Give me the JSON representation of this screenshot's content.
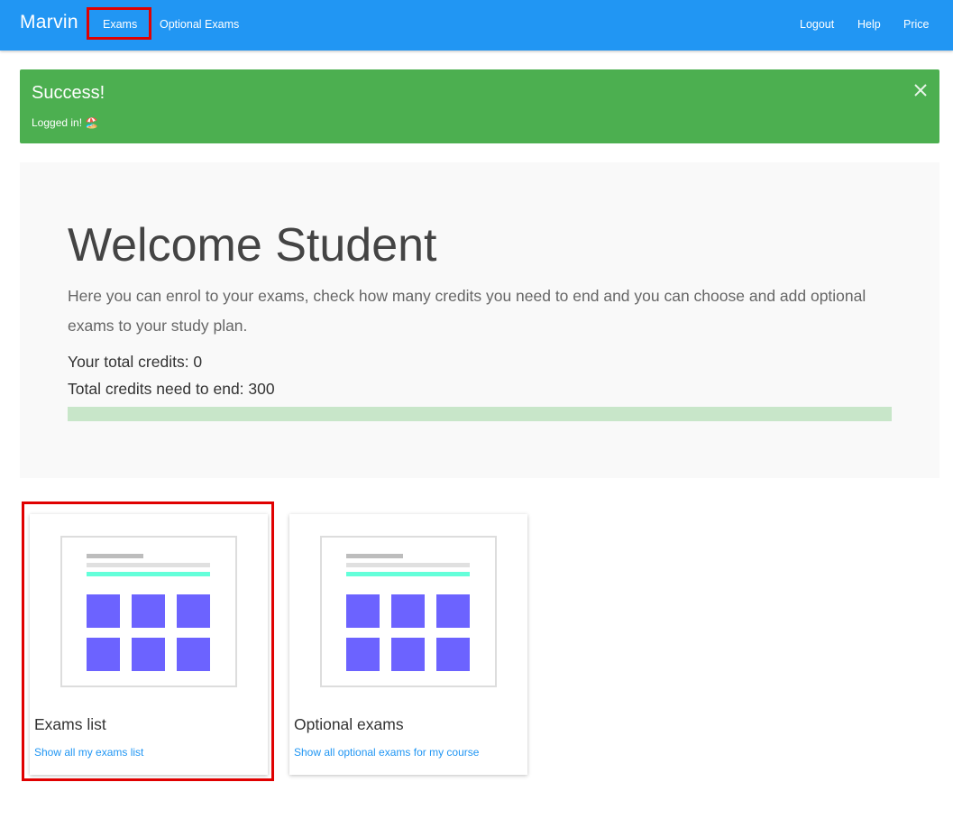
{
  "navbar": {
    "brand": "Marvin",
    "links": [
      {
        "label": "Exams"
      },
      {
        "label": "Optional Exams"
      }
    ],
    "right_links": [
      {
        "label": "Logout"
      },
      {
        "label": "Help"
      },
      {
        "label": "Price"
      }
    ],
    "color": "#2196f3"
  },
  "alert": {
    "title": "Success!",
    "message": "Logged in! 🏖️",
    "close_icon": "close-icon",
    "color": "#4caf50"
  },
  "jumbotron": {
    "title": "Welcome Student",
    "lead": "Here you can enrol to your exams, check how many credits you need to end and you can choose and add optional exams to your study plan.",
    "total_credits_label": "Your total credits: 0",
    "credits_needed_label": "Total credits need to end: 300",
    "progress_fraction": 0,
    "progress_color": "#c8e6c9"
  },
  "cards": [
    {
      "title": "Exams list",
      "link": "Show all my exams list",
      "icon": "exam-grid-illustration"
    },
    {
      "title": "Optional exams",
      "link": "Show all optional exams for my course",
      "icon": "exam-grid-illustration"
    }
  ],
  "colors": {
    "tile": "#6c63ff",
    "accent_line": "#64ffda",
    "highlight": "#e00000"
  }
}
